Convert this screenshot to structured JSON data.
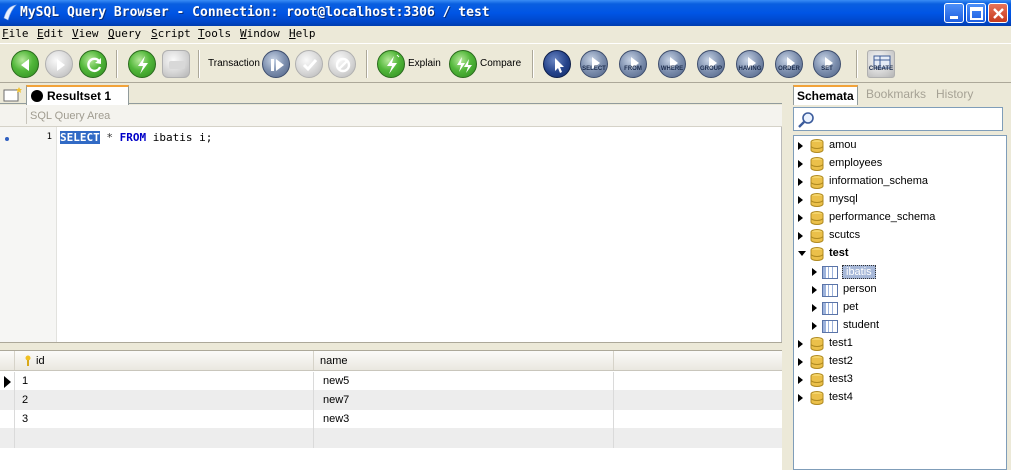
{
  "window": {
    "title": "MySQL Query Browser - Connection: root@localhost:3306 / test",
    "controls": [
      "minimize-icon",
      "maximize-icon",
      "close-icon"
    ]
  },
  "menu": [
    "File",
    "Edit",
    "View",
    "Query",
    "Script",
    "Tools",
    "Window",
    "Help"
  ],
  "toolbar": {
    "transaction_label": "Transaction",
    "explain_label": "Explain",
    "compare_label": "Compare",
    "clause_buttons": [
      "SELECT",
      "FROM",
      "WHERE",
      "GROUP",
      "HAVING",
      "ORDER",
      "SET"
    ],
    "create_label": "CREATE"
  },
  "tabs": [
    {
      "label": "Resultset 1",
      "active": true
    }
  ],
  "query": {
    "area_label": "SQL Query Area",
    "line_number": "1",
    "tokens": {
      "select": "SELECT",
      "star": " * ",
      "from": "FROM",
      "rest": " ibatis i;"
    }
  },
  "grid": {
    "columns": [
      "id",
      "name"
    ],
    "rows": [
      {
        "id": "1",
        "name": "new5"
      },
      {
        "id": "2",
        "name": "new7"
      },
      {
        "id": "3",
        "name": "new3"
      }
    ]
  },
  "schemata": {
    "tabs": [
      "Schemata",
      "Bookmarks",
      "History"
    ],
    "databases": [
      "amou",
      "employees",
      "information_schema",
      "mysql",
      "performance_schema",
      "scutcs",
      "test"
    ],
    "test_tables": [
      "ibatis",
      "person",
      "pet",
      "student"
    ],
    "more_databases": [
      "test1",
      "test2",
      "test3",
      "test4"
    ],
    "selected_table": "ibatis"
  },
  "colors": {
    "titlebar": "#0055E5",
    "selection": "#316AC5",
    "keyword": "#0000C8",
    "tab_accent": "#F2A33A"
  }
}
